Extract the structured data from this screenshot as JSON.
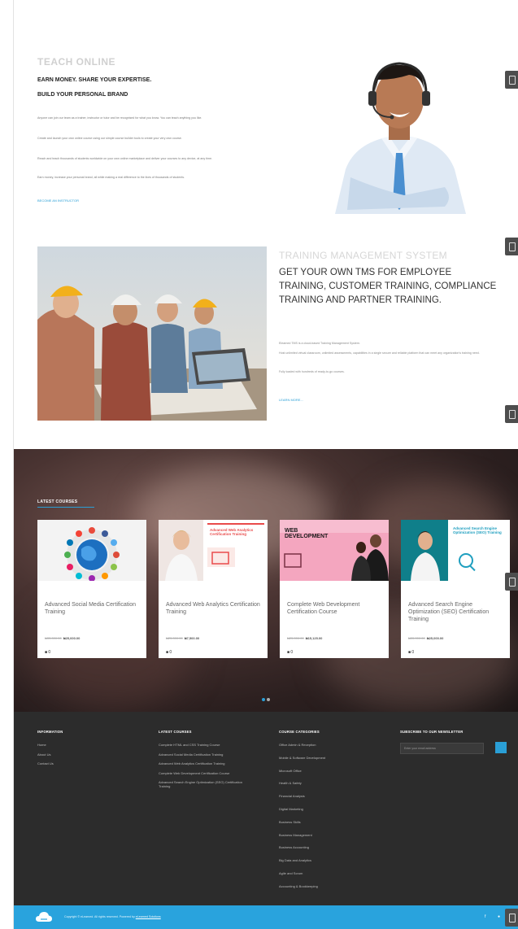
{
  "teach": {
    "eyebrow": "TEACH ONLINE",
    "headline1": "EARN MONEY. SHARE YOUR EXPERTISE.",
    "headline2": "BUILD YOUR PERSONAL BRAND",
    "paragraphs": [
      "Anyone can join our team as a trainer, instructor or tutor and be recognised for what you know. You can teach anything you like.",
      "Create and launch your own online course using our simple course builder tools to create your very own course.",
      "Reach and teach thousands of students worldwide on your own online marketplace and deliver your courses to any device, at any time.",
      "Earn money, increase your personal brand, all while making a real difference to the lives of thousands of students."
    ],
    "link": "BECOME AN INSTRUCTOR"
  },
  "tms": {
    "eyebrow": "TRAINING MANAGEMENT SYSTEM",
    "headline": "GET YOUR OWN TMS FOR EMPLOYEE TRAINING, CUSTOMER TRAINING, COMPLIANCE TRAINING AND PARTNER TRAINING.",
    "paragraphs": [
      "Elearned TMS is a cloud-based Training Management System.",
      "Host unlimited virtual classroom, unlimited assessments, capabilities in a single secure and reliable platform that can meet any organization's training need.",
      "Fully loaded with hundreds of ready-to-go courses."
    ],
    "link": "LEARN MORE..."
  },
  "latest": {
    "title": "LATEST COURSES",
    "courses": [
      {
        "title": "Advanced Social Media Certification Training",
        "old_price": "₦35,000.00",
        "price": "₦25,000.00",
        "students": "0"
      },
      {
        "title": "Advanced Web Analytics Certification Training",
        "old_price": "₦25,000.00",
        "price": "₦7,500.00",
        "students": "0"
      },
      {
        "title": "Complete Web Development Certification Course",
        "old_price": "₦25,000.00",
        "price": "₦15,125.00",
        "students": "0"
      },
      {
        "title": "Advanced Search Engine Optimization (SEO) Certification Training",
        "old_price": "₦35,000.00",
        "price": "₦25,000.00",
        "students": "0"
      }
    ],
    "thumb2_text": "Advanced Web Analytics Certification Training",
    "thumb3_text": "WEB DEVELOPMENT",
    "thumb4_text": "Advanced Search Engine Optimization (SEO) Training"
  },
  "footer": {
    "info": {
      "title": "INFORMATION",
      "items": [
        "Home",
        "About Us",
        "Contact Us"
      ]
    },
    "latest": {
      "title": "LATEST COURSES",
      "items": [
        "Complete HTML and CSS Training Course",
        "Advanced Social Media Certification Training",
        "Advanced Web Analytics Certification Training",
        "Complete Web Development Certification Course",
        "Advanced Search Engine Optimization (SEO) Certification Training"
      ]
    },
    "categories": {
      "title": "COURSE CATEGORIES",
      "items": [
        "Office Admin & Reception",
        "Mobile & Software Development",
        "Microsoft Office",
        "Health & Safety",
        "Financial Analysis",
        "Digital Marketing",
        "Business Skills",
        "Business Management",
        "Business Accounting",
        "Big Data and Analytics",
        "Agile and Scrum",
        "Accounting & Bookkeeping"
      ]
    },
    "newsletter": {
      "title": "SUBSCRIBE TO OUR NEWSLETTER",
      "placeholder": "Enter your email address"
    }
  },
  "bottombar": {
    "copyright": "Copyright © eLearned. All rights reserved. Powered by",
    "link": "eLearned Solutions"
  },
  "colors": {
    "accent": "#2a9fd6",
    "footer_bg": "#2c2c2c",
    "bottombar_bg": "#29a3dd"
  },
  "icons": [
    "scroll-to-section-icon",
    "cloud-logo-icon",
    "user-icon",
    "facebook-icon",
    "twitter-icon"
  ]
}
